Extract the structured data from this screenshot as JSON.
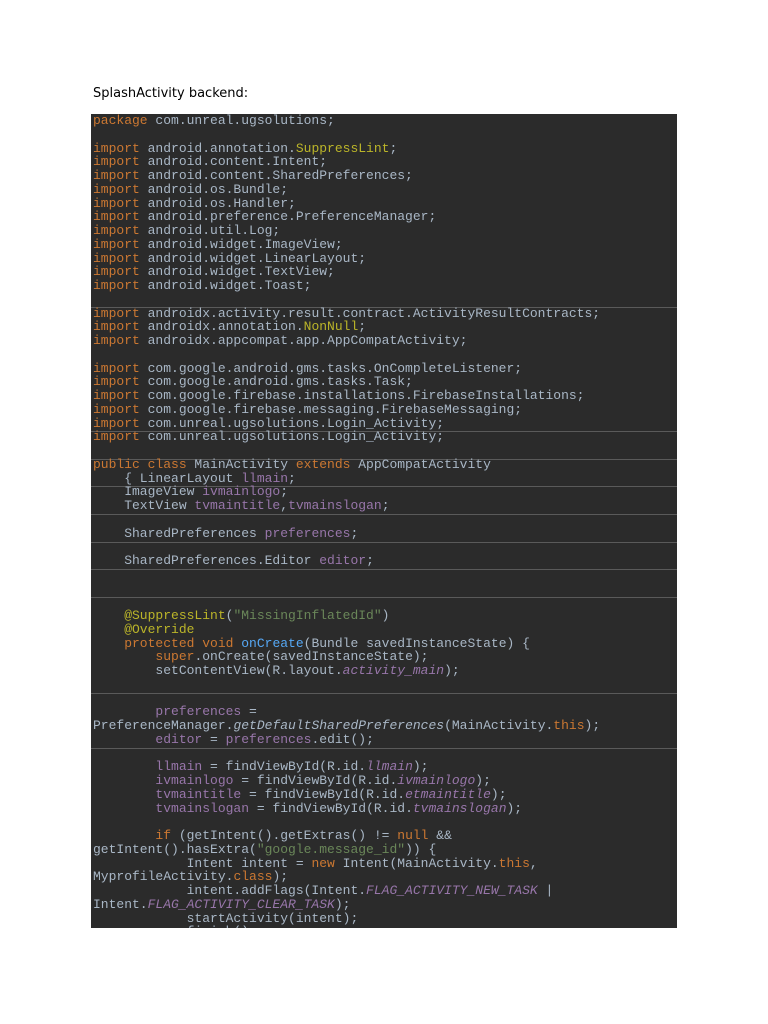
{
  "document": {
    "heading": "SplashActivity backend:"
  },
  "code": {
    "lines": [
      [
        {
          "t": "package",
          "c": "kw"
        },
        {
          "t": " com.unreal.ugsolutions;",
          "c": "tx"
        }
      ],
      [],
      [
        {
          "t": "import",
          "c": "kw"
        },
        {
          "t": " android.annotation.",
          "c": "tx"
        },
        {
          "t": "SuppressLint",
          "c": "an"
        },
        {
          "t": ";",
          "c": "tx"
        }
      ],
      [
        {
          "t": "import",
          "c": "kw"
        },
        {
          "t": " android.content.Intent;",
          "c": "tx"
        }
      ],
      [
        {
          "t": "import",
          "c": "kw"
        },
        {
          "t": " android.content.SharedPreferences;",
          "c": "tx"
        }
      ],
      [
        {
          "t": "import",
          "c": "kw"
        },
        {
          "t": " android.os.Bundle;",
          "c": "tx"
        }
      ],
      [
        {
          "t": "import",
          "c": "kw"
        },
        {
          "t": " android.os.Handler;",
          "c": "tx"
        }
      ],
      [
        {
          "t": "import",
          "c": "kw"
        },
        {
          "t": " android.preference.PreferenceManager;",
          "c": "tx"
        }
      ],
      [
        {
          "t": "import",
          "c": "kw"
        },
        {
          "t": " android.util.Log;",
          "c": "tx"
        }
      ],
      [
        {
          "t": "import",
          "c": "kw"
        },
        {
          "t": " android.widget.ImageView;",
          "c": "tx"
        }
      ],
      [
        {
          "t": "import",
          "c": "kw"
        },
        {
          "t": " android.widget.LinearLayout;",
          "c": "tx"
        }
      ],
      [
        {
          "t": "import",
          "c": "kw"
        },
        {
          "t": " android.widget.TextView;",
          "c": "tx"
        }
      ],
      [
        {
          "t": "import",
          "c": "kw"
        },
        {
          "t": " android.widget.Toast;",
          "c": "tx"
        }
      ],
      [],
      [
        {
          "t": "import",
          "c": "kw"
        },
        {
          "t": " androidx.activity.result.contract.ActivityResultContracts;",
          "c": "tx"
        }
      ],
      [
        {
          "t": "import",
          "c": "kw"
        },
        {
          "t": " androidx.annotation.",
          "c": "tx"
        },
        {
          "t": "NonNull",
          "c": "an"
        },
        {
          "t": ";",
          "c": "tx"
        }
      ],
      [
        {
          "t": "import",
          "c": "kw"
        },
        {
          "t": " androidx.appcompat.app.AppCompatActivity;",
          "c": "tx"
        }
      ],
      [],
      [
        {
          "t": "import",
          "c": "kw"
        },
        {
          "t": " com.google.android.gms.tasks.OnCompleteListener;",
          "c": "tx"
        }
      ],
      [
        {
          "t": "import",
          "c": "kw"
        },
        {
          "t": " com.google.android.gms.tasks.Task;",
          "c": "tx"
        }
      ],
      [
        {
          "t": "import",
          "c": "kw"
        },
        {
          "t": " com.google.firebase.installations.FirebaseInstallations;",
          "c": "tx"
        }
      ],
      [
        {
          "t": "import",
          "c": "kw"
        },
        {
          "t": " com.google.firebase.messaging.FirebaseMessaging;",
          "c": "tx"
        }
      ],
      [
        {
          "t": "import",
          "c": "kw"
        },
        {
          "t": " com.unreal.ugsolutions.Login_Activity;",
          "c": "tx"
        }
      ],
      [
        {
          "t": "import",
          "c": "kw"
        },
        {
          "t": " com.unreal.ugsolutions.Login_Activity;",
          "c": "tx"
        }
      ],
      [],
      [
        {
          "t": "public class",
          "c": "kw"
        },
        {
          "t": " MainActivity ",
          "c": "tx"
        },
        {
          "t": "extends",
          "c": "kw"
        },
        {
          "t": " AppCompatActivity",
          "c": "tx"
        }
      ],
      [
        {
          "t": "    { LinearLayout ",
          "c": "tx"
        },
        {
          "t": "llmain",
          "c": "fd"
        },
        {
          "t": ";",
          "c": "tx"
        }
      ],
      [
        {
          "t": "    ImageView ",
          "c": "tx"
        },
        {
          "t": "ivmainlogo",
          "c": "fd"
        },
        {
          "t": ";",
          "c": "tx"
        }
      ],
      [
        {
          "t": "    TextView ",
          "c": "tx"
        },
        {
          "t": "tvmaintitle",
          "c": "fd"
        },
        {
          "t": ",",
          "c": "tx"
        },
        {
          "t": "tvmainslogan",
          "c": "fd"
        },
        {
          "t": ";",
          "c": "tx"
        }
      ],
      [],
      [
        {
          "t": "    SharedPreferences ",
          "c": "tx"
        },
        {
          "t": "preferences",
          "c": "fd"
        },
        {
          "t": ";",
          "c": "tx"
        }
      ],
      [],
      [
        {
          "t": "    SharedPreferences.Editor ",
          "c": "tx"
        },
        {
          "t": "editor",
          "c": "fd"
        },
        {
          "t": ";",
          "c": "tx"
        }
      ],
      [],
      [],
      [],
      [
        {
          "t": "    @SuppressLint",
          "c": "an"
        },
        {
          "t": "(",
          "c": "tx"
        },
        {
          "t": "\"MissingInflatedId\"",
          "c": "st"
        },
        {
          "t": ")",
          "c": "tx"
        }
      ],
      [
        {
          "t": "    @Override",
          "c": "an"
        }
      ],
      [
        {
          "t": "    protected void ",
          "c": "kw"
        },
        {
          "t": "onCreate",
          "c": "mn"
        },
        {
          "t": "(Bundle savedInstanceState) {",
          "c": "tx"
        }
      ],
      [
        {
          "t": "        ",
          "c": "tx"
        },
        {
          "t": "super",
          "c": "kw"
        },
        {
          "t": ".onCreate(savedInstanceState);",
          "c": "tx"
        }
      ],
      [
        {
          "t": "        setContentView(R.layout.",
          "c": "tx"
        },
        {
          "t": "activity_main",
          "c": "fd it"
        },
        {
          "t": ");",
          "c": "tx"
        }
      ],
      [],
      [],
      [
        {
          "t": "        ",
          "c": "tx"
        },
        {
          "t": "preferences",
          "c": "fd"
        },
        {
          "t": " =",
          "c": "tx"
        }
      ],
      [
        {
          "t": "PreferenceManager.",
          "c": "tx"
        },
        {
          "t": "getDefaultSharedPreferences",
          "c": "tx it"
        },
        {
          "t": "(MainActivity.",
          "c": "tx"
        },
        {
          "t": "this",
          "c": "kw"
        },
        {
          "t": ");",
          "c": "tx"
        }
      ],
      [
        {
          "t": "        ",
          "c": "tx"
        },
        {
          "t": "editor",
          "c": "fd"
        },
        {
          "t": " = ",
          "c": "tx"
        },
        {
          "t": "preferences",
          "c": "fd"
        },
        {
          "t": ".edit();",
          "c": "tx"
        }
      ],
      [],
      [
        {
          "t": "        ",
          "c": "tx"
        },
        {
          "t": "llmain",
          "c": "fd"
        },
        {
          "t": " = findViewById(R.id.",
          "c": "tx"
        },
        {
          "t": "llmain",
          "c": "fd it"
        },
        {
          "t": ");",
          "c": "tx"
        }
      ],
      [
        {
          "t": "        ",
          "c": "tx"
        },
        {
          "t": "ivmainlogo",
          "c": "fd"
        },
        {
          "t": " = findViewById(R.id.",
          "c": "tx"
        },
        {
          "t": "ivmainlogo",
          "c": "fd it"
        },
        {
          "t": ");",
          "c": "tx"
        }
      ],
      [
        {
          "t": "        ",
          "c": "tx"
        },
        {
          "t": "tvmaintitle",
          "c": "fd"
        },
        {
          "t": " = findViewById(R.id.",
          "c": "tx"
        },
        {
          "t": "etmaintitle",
          "c": "fd it"
        },
        {
          "t": ");",
          "c": "tx"
        }
      ],
      [
        {
          "t": "        ",
          "c": "tx"
        },
        {
          "t": "tvmainslogan",
          "c": "fd"
        },
        {
          "t": " = findViewById(R.id.",
          "c": "tx"
        },
        {
          "t": "tvmainslogan",
          "c": "fd it"
        },
        {
          "t": ");",
          "c": "tx"
        }
      ],
      [],
      [
        {
          "t": "        ",
          "c": "tx"
        },
        {
          "t": "if",
          "c": "kw"
        },
        {
          "t": " (getIntent().getExtras() != ",
          "c": "tx"
        },
        {
          "t": "null",
          "c": "kw"
        },
        {
          "t": " &&",
          "c": "tx"
        }
      ],
      [
        {
          "t": "getIntent().hasExtra(",
          "c": "tx"
        },
        {
          "t": "\"google.message_id\"",
          "c": "st"
        },
        {
          "t": ")) {",
          "c": "tx"
        }
      ],
      [
        {
          "t": "            Intent intent = ",
          "c": "tx"
        },
        {
          "t": "new",
          "c": "kw"
        },
        {
          "t": " Intent(MainActivity.",
          "c": "tx"
        },
        {
          "t": "this",
          "c": "kw"
        },
        {
          "t": ",",
          "c": "tx"
        }
      ],
      [
        {
          "t": "MyprofileActivity.",
          "c": "tx"
        },
        {
          "t": "class",
          "c": "kw"
        },
        {
          "t": ");",
          "c": "tx"
        }
      ],
      [
        {
          "t": "            intent.addFlags(Intent.",
          "c": "tx"
        },
        {
          "t": "FLAG_ACTIVITY_NEW_TASK",
          "c": "fd it"
        },
        {
          "t": " |",
          "c": "tx"
        }
      ],
      [
        {
          "t": "Intent.",
          "c": "tx"
        },
        {
          "t": "FLAG_ACTIVITY_CLEAR_TASK",
          "c": "fd it"
        },
        {
          "t": ");",
          "c": "tx"
        }
      ],
      [
        {
          "t": "            startActivity(intent);",
          "c": "tx"
        }
      ],
      [
        {
          "t": "            finish();",
          "c": "tx"
        }
      ]
    ]
  },
  "colors": {
    "background": "#2b2b2b",
    "plain": "#a9b7c6",
    "keyword": "#cc7832",
    "annotation": "#bbb529",
    "field": "#9876aa",
    "string": "#6a8759",
    "method": "#56a8f5"
  }
}
